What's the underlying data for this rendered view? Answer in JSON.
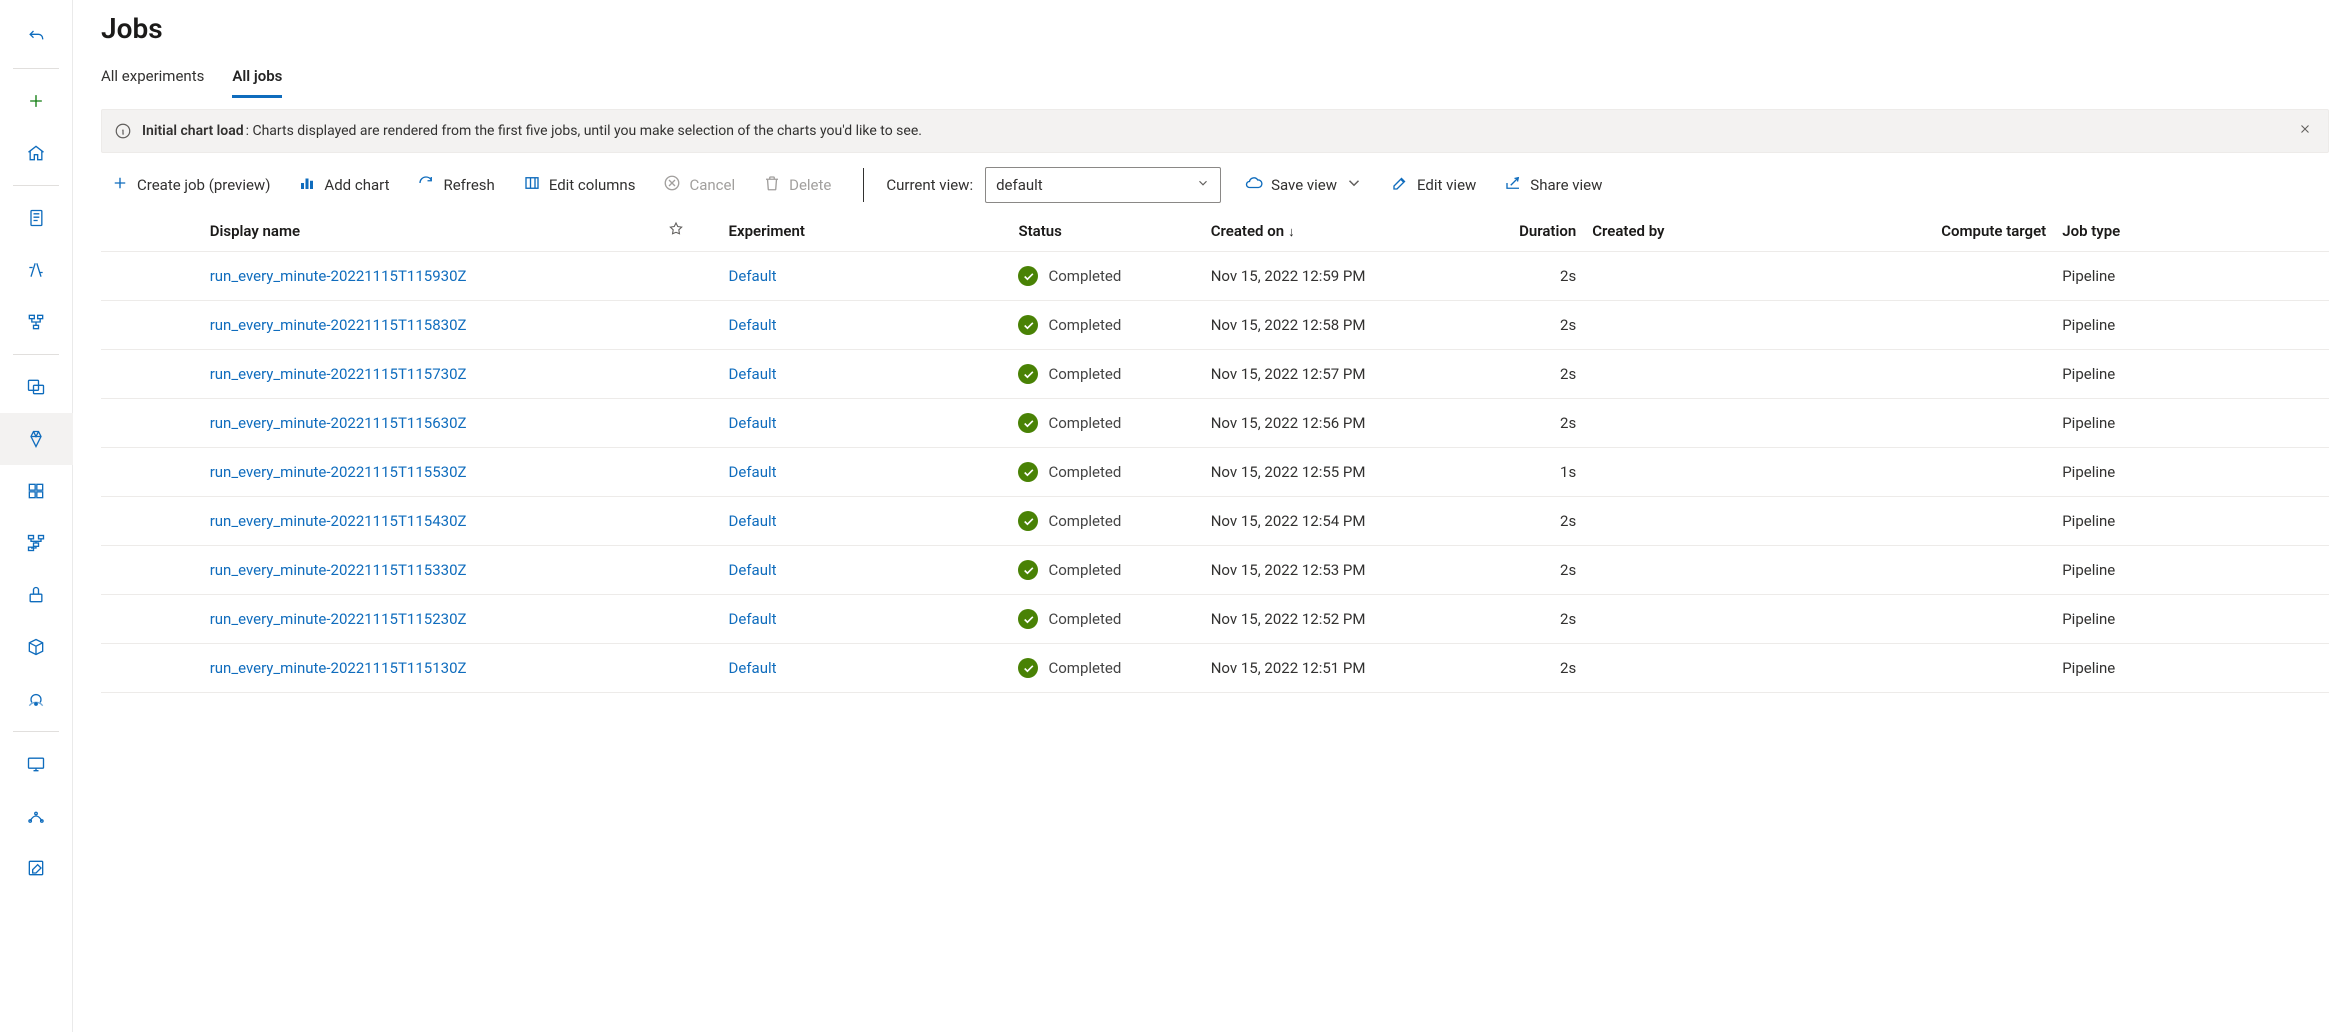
{
  "page_title": "Jobs",
  "tabs": [
    {
      "label": "All experiments",
      "active": false
    },
    {
      "label": "All jobs",
      "active": true
    }
  ],
  "banner": {
    "bold": "Initial chart load",
    "text": ": Charts displayed are rendered from the first five jobs, until you make selection of the charts you'd like to see."
  },
  "toolbar": {
    "create_job": "Create job (preview)",
    "add_chart": "Add chart",
    "refresh": "Refresh",
    "edit_columns": "Edit columns",
    "cancel": "Cancel",
    "delete": "Delete",
    "current_view_label": "Current view:",
    "current_view_value": "default",
    "save_view": "Save view",
    "edit_view": "Edit view",
    "share_view": "Share view"
  },
  "columns": {
    "display_name": "Display name",
    "experiment": "Experiment",
    "status": "Status",
    "created_on": "Created on",
    "duration": "Duration",
    "created_by": "Created by",
    "compute_target": "Compute target",
    "job_type": "Job type"
  },
  "rows": [
    {
      "display": "run_every_minute-20221115T115930Z",
      "experiment": "Default",
      "status": "Completed",
      "created": "Nov 15, 2022 12:59 PM",
      "duration": "2s",
      "created_by": "",
      "compute": "",
      "job_type": "Pipeline"
    },
    {
      "display": "run_every_minute-20221115T115830Z",
      "experiment": "Default",
      "status": "Completed",
      "created": "Nov 15, 2022 12:58 PM",
      "duration": "2s",
      "created_by": "",
      "compute": "",
      "job_type": "Pipeline"
    },
    {
      "display": "run_every_minute-20221115T115730Z",
      "experiment": "Default",
      "status": "Completed",
      "created": "Nov 15, 2022 12:57 PM",
      "duration": "2s",
      "created_by": "",
      "compute": "",
      "job_type": "Pipeline"
    },
    {
      "display": "run_every_minute-20221115T115630Z",
      "experiment": "Default",
      "status": "Completed",
      "created": "Nov 15, 2022 12:56 PM",
      "duration": "2s",
      "created_by": "",
      "compute": "",
      "job_type": "Pipeline"
    },
    {
      "display": "run_every_minute-20221115T115530Z",
      "experiment": "Default",
      "status": "Completed",
      "created": "Nov 15, 2022 12:55 PM",
      "duration": "1s",
      "created_by": "",
      "compute": "",
      "job_type": "Pipeline"
    },
    {
      "display": "run_every_minute-20221115T115430Z",
      "experiment": "Default",
      "status": "Completed",
      "created": "Nov 15, 2022 12:54 PM",
      "duration": "2s",
      "created_by": "",
      "compute": "",
      "job_type": "Pipeline"
    },
    {
      "display": "run_every_minute-20221115T115330Z",
      "experiment": "Default",
      "status": "Completed",
      "created": "Nov 15, 2022 12:53 PM",
      "duration": "2s",
      "created_by": "",
      "compute": "",
      "job_type": "Pipeline"
    },
    {
      "display": "run_every_minute-20221115T115230Z",
      "experiment": "Default",
      "status": "Completed",
      "created": "Nov 15, 2022 12:52 PM",
      "duration": "2s",
      "created_by": "",
      "compute": "",
      "job_type": "Pipeline"
    },
    {
      "display": "run_every_minute-20221115T115130Z",
      "experiment": "Default",
      "status": "Completed",
      "created": "Nov 15, 2022 12:51 PM",
      "duration": "2s",
      "created_by": "",
      "compute": "",
      "job_type": "Pipeline"
    }
  ]
}
